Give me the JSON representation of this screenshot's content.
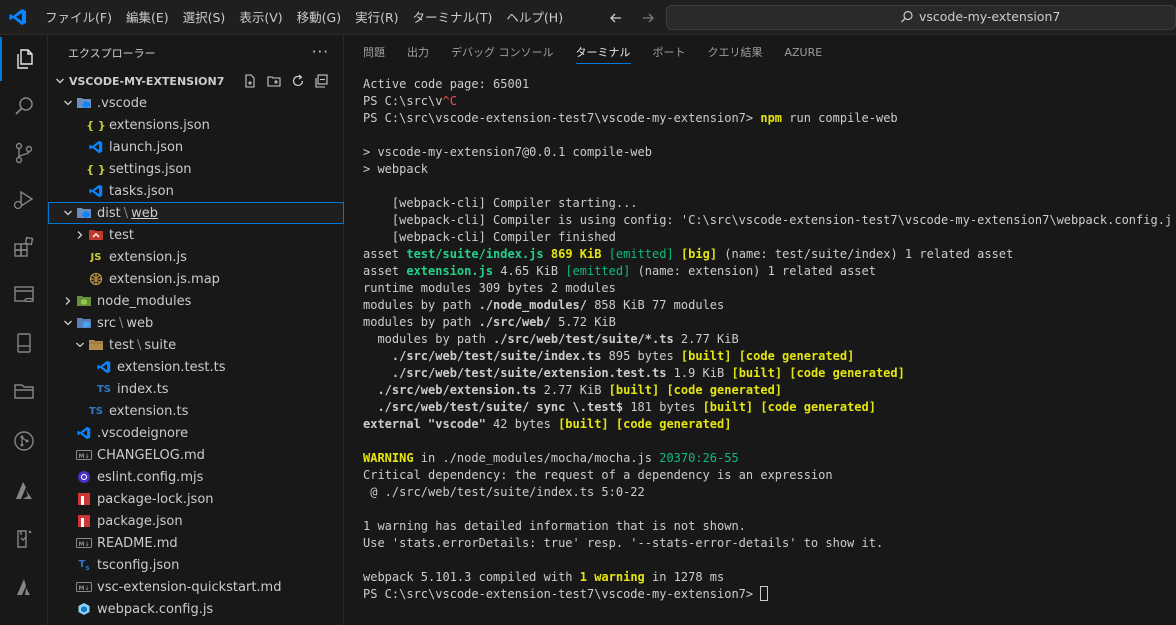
{
  "colors": {
    "accent": "#0078d4",
    "terminal_yellow": "#e5e510",
    "terminal_green": "#23d18b",
    "terminal_red": "#f14c4c",
    "json_icon": "#cbcb41",
    "js_icon": "#cbcb41",
    "ts_icon": "#3178c6",
    "vscode_icon": "#0a84ff",
    "npm_icon": "#cb3837"
  },
  "menu": [
    "ファイル(F)",
    "編集(E)",
    "選択(S)",
    "表示(V)",
    "移動(G)",
    "実行(R)",
    "ターミナル(T)",
    "ヘルプ(H)"
  ],
  "command_center": {
    "text": "vscode-my-extension7",
    "icon": "search-icon"
  },
  "activity_bar": [
    {
      "name": "explorer-icon",
      "active": true
    },
    {
      "name": "search-icon"
    },
    {
      "name": "source-control-icon"
    },
    {
      "name": "run-debug-icon"
    },
    {
      "name": "extensions-icon"
    },
    {
      "name": "remote-explorer-icon"
    },
    {
      "name": "database-icon"
    },
    {
      "name": "folder-icon"
    },
    {
      "name": "github-icon"
    },
    {
      "name": "azure-icon"
    },
    {
      "name": "test-icon"
    },
    {
      "name": "azure-ai-icon"
    }
  ],
  "sidebar": {
    "title": "エクスプローラー",
    "more": "···",
    "section": "VSCODE-MY-EXTENSION7",
    "tree": [
      {
        "label": ".vscode",
        "depth": 1,
        "kind": "folder-vscode",
        "chevron": "down"
      },
      {
        "label": "extensions.json",
        "depth": 2,
        "kind": "json"
      },
      {
        "label": "launch.json",
        "depth": 2,
        "kind": "vscode"
      },
      {
        "label": "settings.json",
        "depth": 2,
        "kind": "json"
      },
      {
        "label": "tasks.json",
        "depth": 2,
        "kind": "vscode"
      },
      {
        "label": "dist",
        "label2": "web",
        "depth": 1,
        "kind": "folder-vscode",
        "chevron": "down",
        "selected": true
      },
      {
        "label": "test",
        "depth": 2,
        "kind": "folder-test",
        "chevron": "right"
      },
      {
        "label": "extension.js",
        "depth": 2,
        "kind": "js"
      },
      {
        "label": "extension.js.map",
        "depth": 2,
        "kind": "map"
      },
      {
        "label": "node_modules",
        "depth": 1,
        "kind": "folder-node",
        "chevron": "right"
      },
      {
        "label": "src",
        "label2": "web",
        "depth": 1,
        "kind": "folder-src",
        "chevron": "down"
      },
      {
        "label": "test",
        "label2": "suite",
        "depth": 2,
        "kind": "folder-test2",
        "chevron": "down"
      },
      {
        "label": "extension.test.ts",
        "depth": 3,
        "kind": "vscode"
      },
      {
        "label": "index.ts",
        "depth": 3,
        "kind": "ts"
      },
      {
        "label": "extension.ts",
        "depth": 2,
        "kind": "ts"
      },
      {
        "label": ".vscodeignore",
        "depth": 1,
        "kind": "vscode"
      },
      {
        "label": "CHANGELOG.md",
        "depth": 1,
        "kind": "md"
      },
      {
        "label": "eslint.config.mjs",
        "depth": 1,
        "kind": "eslint"
      },
      {
        "label": "package-lock.json",
        "depth": 1,
        "kind": "npm"
      },
      {
        "label": "package.json",
        "depth": 1,
        "kind": "npm"
      },
      {
        "label": "README.md",
        "depth": 1,
        "kind": "md"
      },
      {
        "label": "tsconfig.json",
        "depth": 1,
        "kind": "tsconfig"
      },
      {
        "label": "vsc-extension-quickstart.md",
        "depth": 1,
        "kind": "md"
      },
      {
        "label": "webpack.config.js",
        "depth": 1,
        "kind": "webpack"
      }
    ]
  },
  "panel": {
    "tabs": [
      "問題",
      "出力",
      "デバッグ コンソール",
      "ターミナル",
      "ポート",
      "クエリ結果",
      "AZURE"
    ],
    "active_tab": "ターミナル",
    "terminal_lines": [
      [
        [
          "Active code page: 65001",
          ""
        ]
      ],
      [
        [
          "PS C:\\src\\v",
          ""
        ],
        [
          "^C",
          "red"
        ]
      ],
      [
        [
          "PS C:\\src\\vscode-extension-test7\\vscode-my-extension7> ",
          ""
        ],
        [
          "npm",
          "yellow"
        ],
        [
          " run compile-web",
          ""
        ]
      ],
      [],
      [
        [
          "> vscode-my-extension7@0.0.1 compile-web",
          ""
        ]
      ],
      [
        [
          "> webpack",
          ""
        ]
      ],
      [],
      [
        [
          "    [webpack-cli] Compiler starting...",
          ""
        ]
      ],
      [
        [
          "    [webpack-cli] Compiler is using config: 'C:\\src\\vscode-extension-test7\\vscode-my-extension7\\webpack.config.js'",
          ""
        ]
      ],
      [
        [
          "    [webpack-cli] Compiler finished",
          ""
        ]
      ],
      [
        [
          "asset ",
          ""
        ],
        [
          "test/suite/index.js",
          "green"
        ],
        [
          " ",
          ""
        ],
        [
          "869 KiB",
          "yellow"
        ],
        [
          " ",
          ""
        ],
        [
          "[emitted]",
          "gnorm"
        ],
        [
          " ",
          ""
        ],
        [
          "[big]",
          "yellow"
        ],
        [
          " (name: test/suite/index) 1 related asset",
          ""
        ]
      ],
      [
        [
          "asset ",
          ""
        ],
        [
          "extension.js",
          "green"
        ],
        [
          " 4.65 KiB ",
          ""
        ],
        [
          "[emitted]",
          "gnorm"
        ],
        [
          " (name: extension) 1 related asset",
          ""
        ]
      ],
      [
        [
          "runtime modules 309 bytes 2 modules",
          ""
        ]
      ],
      [
        [
          "modules by path ",
          ""
        ],
        [
          "./node_modules/",
          "bold"
        ],
        [
          " 858 KiB 77 modules",
          ""
        ]
      ],
      [
        [
          "modules by path ",
          ""
        ],
        [
          "./src/web/",
          "bold"
        ],
        [
          " 5.72 KiB",
          ""
        ]
      ],
      [
        [
          "  modules by path ",
          ""
        ],
        [
          "./src/web/test/suite/*.ts",
          "bold"
        ],
        [
          " 2.77 KiB",
          ""
        ]
      ],
      [
        [
          "    ./src/web/test/suite/index.ts",
          "bold"
        ],
        [
          " 895 bytes ",
          ""
        ],
        [
          "[built] [code generated]",
          "yellow"
        ]
      ],
      [
        [
          "    ./src/web/test/suite/extension.test.ts",
          "bold"
        ],
        [
          " 1.9 KiB ",
          ""
        ],
        [
          "[built] [code generated]",
          "yellow"
        ]
      ],
      [
        [
          "  ./src/web/extension.ts",
          "bold"
        ],
        [
          " 2.77 KiB ",
          ""
        ],
        [
          "[built] [code generated]",
          "yellow"
        ]
      ],
      [
        [
          "  ./src/web/test/suite/ sync \\.test$",
          "bold"
        ],
        [
          " 181 bytes ",
          ""
        ],
        [
          "[built] [code generated]",
          "yellow"
        ]
      ],
      [
        [
          "external \"vscode\"",
          "bold"
        ],
        [
          " 42 bytes ",
          ""
        ],
        [
          "[built] [code generated]",
          "yellow"
        ]
      ],
      [],
      [
        [
          "WARNING",
          "yellow"
        ],
        [
          " in ./node_modules/mocha/mocha.js ",
          ""
        ],
        [
          "20370:26-55",
          "gnorm"
        ]
      ],
      [
        [
          "Critical dependency: the request of a dependency is an expression",
          ""
        ]
      ],
      [
        [
          " @ ./src/web/test/suite/index.ts 5:0-22",
          ""
        ]
      ],
      [],
      [
        [
          "1 warning has detailed information that is not shown.",
          ""
        ]
      ],
      [
        [
          "Use 'stats.errorDetails: true' resp. '--stats-error-details' to show it.",
          ""
        ]
      ],
      [],
      [
        [
          "webpack 5.101.3 compiled with ",
          ""
        ],
        [
          "1 warning",
          "yellow"
        ],
        [
          " in 1278 ms",
          ""
        ]
      ],
      [
        [
          "PS C:\\src\\vscode-extension-test7\\vscode-my-extension7> ",
          ""
        ],
        [
          "",
          "cursor"
        ]
      ]
    ]
  }
}
